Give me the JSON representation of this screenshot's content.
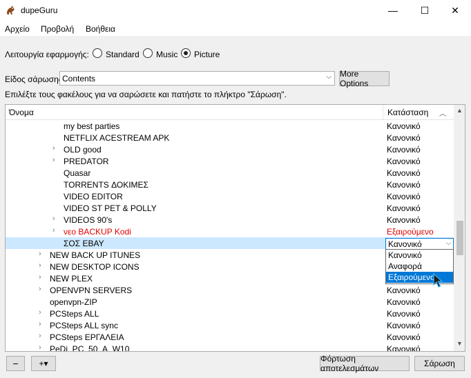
{
  "window": {
    "title": "dupeGuru",
    "minimize_glyph": "—",
    "maximize_glyph": "☐",
    "close_glyph": "✕"
  },
  "menu": [
    "Αρχείο",
    "Προβολή",
    "Βοήθεια"
  ],
  "mode": {
    "label": "Λειτουργία εφαρμογής:",
    "options": [
      "Standard",
      "Music",
      "Picture"
    ],
    "selected": "Picture"
  },
  "scan": {
    "label": "Είδος σάρωσης",
    "selected": "Contents",
    "more_options": "More Options"
  },
  "instructions": "Επιλέξτε τους φακέλους για να σαρώσετε και πατήστε το πλήκτρο \"Σάρωση\".",
  "tree": {
    "col_name": "Όνομα",
    "col_status": "Κατάσταση",
    "rows": [
      {
        "name": "my best parties",
        "status": "Κανονικό",
        "expandable": false,
        "depth": 2,
        "excluded": false,
        "selected": false
      },
      {
        "name": "NETFLIX  ACESTREAM APK",
        "status": "Κανονικό",
        "expandable": false,
        "depth": 2,
        "excluded": false,
        "selected": false
      },
      {
        "name": "OLD good",
        "status": "Κανονικό",
        "expandable": true,
        "depth": 2,
        "excluded": false,
        "selected": false
      },
      {
        "name": "PREDATOR",
        "status": "Κανονικό",
        "expandable": true,
        "depth": 2,
        "excluded": false,
        "selected": false
      },
      {
        "name": "Quasar",
        "status": "Κανονικό",
        "expandable": false,
        "depth": 2,
        "excluded": false,
        "selected": false
      },
      {
        "name": "TORRENTS ΔΟΚΙΜΕΣ",
        "status": "Κανονικό",
        "expandable": false,
        "depth": 2,
        "excluded": false,
        "selected": false
      },
      {
        "name": "VIDEO EDITOR",
        "status": "Κανονικό",
        "expandable": false,
        "depth": 2,
        "excluded": false,
        "selected": false
      },
      {
        "name": "VIDEO ST PET & POLLY",
        "status": "Κανονικό",
        "expandable": false,
        "depth": 2,
        "excluded": false,
        "selected": false
      },
      {
        "name": "VIDEOS 90's",
        "status": "Κανονικό",
        "expandable": true,
        "depth": 2,
        "excluded": false,
        "selected": false
      },
      {
        "name": "νεο BACKUP Kodi",
        "status": "Εξαιρούμενο",
        "expandable": true,
        "depth": 2,
        "excluded": true,
        "selected": false
      },
      {
        "name": "ΣΟΣ EBAY",
        "status": "",
        "expandable": false,
        "depth": 2,
        "excluded": false,
        "selected": true
      },
      {
        "name": "NEW BACK UP ITUNES",
        "status": "",
        "expandable": true,
        "depth": 1,
        "excluded": false,
        "selected": false
      },
      {
        "name": "NEW DESKTOP ICONS",
        "status": "",
        "expandable": true,
        "depth": 1,
        "excluded": false,
        "selected": false
      },
      {
        "name": "NEW PLEX",
        "status": "",
        "expandable": true,
        "depth": 1,
        "excluded": false,
        "selected": false
      },
      {
        "name": "OPENVPN SERVERS",
        "status": "Κανονικό",
        "expandable": true,
        "depth": 1,
        "excluded": false,
        "selected": false
      },
      {
        "name": "openvpn-ZIP",
        "status": "Κανονικό",
        "expandable": false,
        "depth": 1,
        "excluded": false,
        "selected": false
      },
      {
        "name": "PCSteps ALL",
        "status": "Κανονικό",
        "expandable": true,
        "depth": 1,
        "excluded": false,
        "selected": false
      },
      {
        "name": "PCSteps ALL sync",
        "status": "Κανονικό",
        "expandable": true,
        "depth": 1,
        "excluded": false,
        "selected": false
      },
      {
        "name": "PCSteps ΕΡΓΑΛΕΙΑ",
        "status": "Κανονικό",
        "expandable": true,
        "depth": 1,
        "excluded": false,
        "selected": false
      },
      {
        "name": "PeDi_PC_50_A_W10",
        "status": "Κανονικό",
        "expandable": true,
        "depth": 1,
        "excluded": false,
        "selected": false
      }
    ],
    "editor": {
      "value": "Κανονικό",
      "options": [
        "Κανονικό",
        "Αναφορά",
        "Εξαιρούμενο"
      ],
      "hovered": "Εξαιρούμενο"
    }
  },
  "bottom": {
    "minus": "−",
    "plus": "+▾",
    "load_results": "Φόρτωση αποτελεσμάτων",
    "scan": "Σάρωση"
  },
  "colors": {
    "excluded": "#e00000",
    "selection": "#cce8ff",
    "accent": "#0078d7"
  }
}
